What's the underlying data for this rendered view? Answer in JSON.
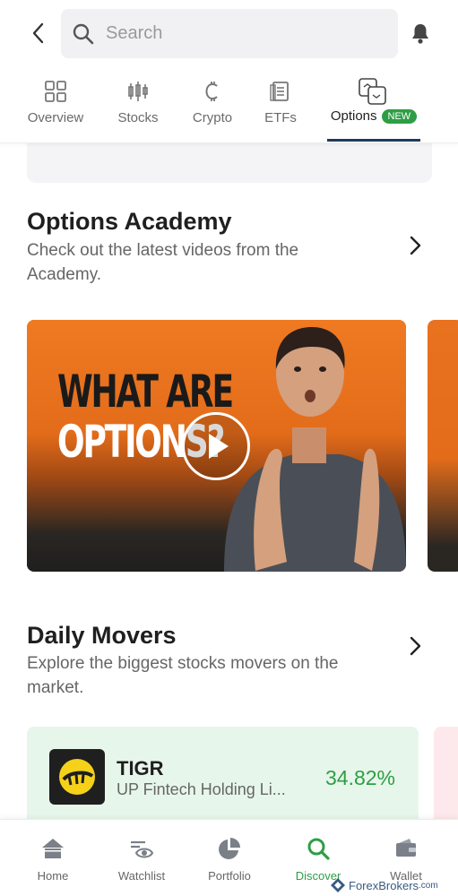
{
  "search": {
    "placeholder": "Search"
  },
  "tabs": [
    {
      "label": "Overview",
      "icon": "grid-icon"
    },
    {
      "label": "Stocks",
      "icon": "candlestick-icon"
    },
    {
      "label": "Crypto",
      "icon": "crypto-icon"
    },
    {
      "label": "ETFs",
      "icon": "document-icon"
    },
    {
      "label": "Options",
      "icon": "options-icon",
      "badge": "NEW",
      "active": true
    }
  ],
  "academy": {
    "title": "Options Academy",
    "subtitle": "Check out the latest videos from the Academy.",
    "video": {
      "line1": "WHAT ARE",
      "line2": "OPTIONS?"
    }
  },
  "movers": {
    "title": "Daily Movers",
    "subtitle": "Explore the biggest stocks movers on the market.",
    "items": [
      {
        "ticker": "TIGR",
        "name": "UP Fintech Holding Li...",
        "change": "34.82%"
      }
    ]
  },
  "nav": [
    {
      "label": "Home",
      "icon": "home-icon"
    },
    {
      "label": "Watchlist",
      "icon": "watchlist-icon"
    },
    {
      "label": "Portfolio",
      "icon": "pie-chart-icon"
    },
    {
      "label": "Discover",
      "icon": "search-icon",
      "active": true
    },
    {
      "label": "Wallet",
      "icon": "wallet-icon"
    }
  ],
  "colors": {
    "accent": "#2e9e45",
    "tab_indicator": "#1e3a5f",
    "video_orange": "#e8721f",
    "mover_bg": "#e7f6ea"
  },
  "watermark": {
    "text": "ForexBrokers",
    "suffix": ".com"
  }
}
